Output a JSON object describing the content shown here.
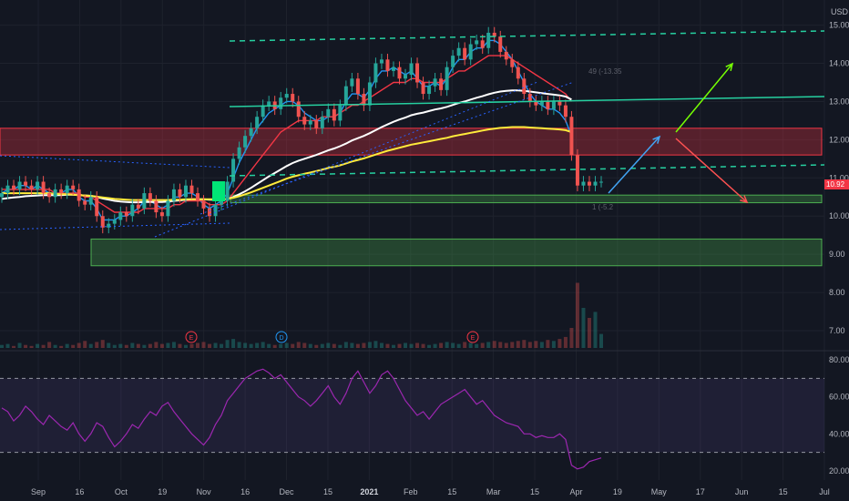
{
  "chart_data": [
    {
      "type": "candlestick",
      "title": "",
      "currency_label": "USD",
      "price_axis": {
        "ylim": [
          6.5,
          15.3
        ],
        "ticks": [
          "15.00",
          "14.00",
          "13.00",
          "12.00",
          "11.00",
          "10.00",
          "9.00",
          "8.00",
          "7.00"
        ]
      },
      "last_price": "10.92",
      "time_axis": [
        "Sep",
        "16",
        "Oct",
        "19",
        "Nov",
        "16",
        "Dec",
        "15",
        "2021",
        "Feb",
        "15",
        "Mar",
        "15",
        "Apr",
        "19",
        "May",
        "17",
        "Jun",
        "15",
        "Jul"
      ],
      "time_axis_bold": [
        "2021"
      ],
      "candles_close": [
        10.6,
        10.8,
        10.7,
        10.9,
        10.8,
        10.7,
        10.9,
        10.6,
        10.5,
        10.7,
        10.6,
        10.8,
        10.7,
        10.4,
        10.3,
        10.5,
        10.0,
        9.7,
        9.8,
        9.9,
        10.1,
        10.0,
        10.3,
        10.2,
        10.6,
        10.4,
        10.1,
        10.0,
        10.4,
        10.7,
        10.5,
        10.8,
        10.6,
        10.4,
        10.2,
        10.0,
        10.3,
        10.4,
        10.9,
        11.5,
        11.8,
        12.1,
        12.3,
        12.6,
        12.9,
        13.0,
        12.8,
        13.1,
        13.2,
        13.0,
        12.6,
        12.4,
        12.5,
        12.3,
        12.6,
        12.8,
        12.5,
        12.9,
        13.4,
        13.6,
        13.2,
        12.9,
        13.5,
        14.0,
        14.1,
        13.8,
        13.9,
        13.6,
        13.7,
        14.0,
        13.5,
        13.2,
        13.4,
        13.6,
        13.3,
        13.9,
        14.2,
        14.4,
        14.1,
        14.5,
        14.6,
        14.4,
        14.8,
        14.7,
        14.3,
        14.1,
        13.9,
        13.6,
        13.2,
        13.0,
        12.9,
        13.0,
        12.8,
        13.0,
        12.9,
        12.6,
        11.6,
        10.8,
        10.9,
        10.8,
        10.9,
        10.9
      ],
      "moving_averages": [
        {
          "color": "#2196f3",
          "values": [
            10.6,
            10.7,
            10.7,
            10.8,
            10.8,
            10.7,
            10.8,
            10.7,
            10.6,
            10.6,
            10.6,
            10.7,
            10.7,
            10.5,
            10.4,
            10.4,
            10.2,
            9.9,
            9.9,
            9.9,
            10.0,
            10.0,
            10.1,
            10.2,
            10.4,
            10.4,
            10.3,
            10.2,
            10.3,
            10.5,
            10.5,
            10.6,
            10.6,
            10.5,
            10.3,
            10.2,
            10.3,
            10.4,
            10.6,
            11.0,
            11.4,
            11.7,
            12.0,
            12.3,
            12.5,
            12.7,
            12.8,
            12.9,
            13.0,
            13.0,
            12.9,
            12.7,
            12.6,
            12.5,
            12.5,
            12.6,
            12.6,
            12.7,
            13.0,
            13.2,
            13.2,
            13.1,
            13.3,
            13.6,
            13.8,
            13.8,
            13.9,
            13.8,
            13.7,
            13.8,
            13.6,
            13.4,
            13.4,
            13.5,
            13.4,
            13.6,
            13.9,
            14.1,
            14.1,
            14.3,
            14.4,
            14.4,
            14.6,
            14.6,
            14.5,
            14.3,
            14.1,
            13.8,
            13.5,
            13.2,
            13.0,
            12.9,
            12.8,
            12.8,
            12.7,
            12.5,
            12.1
          ]
        },
        {
          "color": "#f23645",
          "values": [
            10.7,
            10.7,
            10.7,
            10.7,
            10.7,
            10.7,
            10.7,
            10.7,
            10.7,
            10.6,
            10.6,
            10.6,
            10.6,
            10.6,
            10.5,
            10.5,
            10.4,
            10.3,
            10.2,
            10.1,
            10.1,
            10.1,
            10.1,
            10.1,
            10.2,
            10.2,
            10.2,
            10.2,
            10.2,
            10.3,
            10.3,
            10.4,
            10.4,
            10.4,
            10.4,
            10.3,
            10.3,
            10.3,
            10.4,
            10.6,
            10.8,
            11.0,
            11.2,
            11.4,
            11.6,
            11.8,
            12.0,
            12.2,
            12.3,
            12.4,
            12.5,
            12.5,
            12.5,
            12.5,
            12.6,
            12.6,
            12.6,
            12.7,
            12.8,
            12.9,
            12.9,
            13.0,
            13.1,
            13.2,
            13.3,
            13.4,
            13.5,
            13.5,
            13.5,
            13.6,
            13.6,
            13.5,
            13.5,
            13.5,
            13.5,
            13.6,
            13.7,
            13.8,
            13.8,
            13.9,
            14.0,
            14.1,
            14.2,
            14.2,
            14.2,
            14.2,
            14.1,
            14.0,
            13.9,
            13.8,
            13.7,
            13.6,
            13.5,
            13.4,
            13.3,
            13.2,
            13.0
          ]
        },
        {
          "color": "#ffffff",
          "values": [
            10.45,
            10.47,
            10.49,
            10.5,
            10.52,
            10.53,
            10.54,
            10.55,
            10.55,
            10.55,
            10.55,
            10.56,
            10.56,
            10.55,
            10.54,
            10.53,
            10.5,
            10.46,
            10.43,
            10.4,
            10.38,
            10.37,
            10.36,
            10.36,
            10.37,
            10.37,
            10.37,
            10.37,
            10.38,
            10.4,
            10.41,
            10.43,
            10.44,
            10.44,
            10.44,
            10.43,
            10.43,
            10.43,
            10.45,
            10.5,
            10.57,
            10.65,
            10.74,
            10.84,
            10.94,
            11.04,
            11.13,
            11.22,
            11.31,
            11.39,
            11.45,
            11.5,
            11.55,
            11.6,
            11.66,
            11.72,
            11.77,
            11.83,
            11.9,
            11.98,
            12.04,
            12.1,
            12.17,
            12.25,
            12.33,
            12.4,
            12.47,
            12.53,
            12.58,
            12.64,
            12.68,
            12.71,
            12.75,
            12.79,
            12.82,
            12.86,
            12.91,
            12.96,
            13.0,
            13.05,
            13.1,
            13.14,
            13.19,
            13.23,
            13.26,
            13.28,
            13.29,
            13.29,
            13.28,
            13.26,
            13.24,
            13.22,
            13.2,
            13.18,
            13.16,
            13.13,
            13.05
          ]
        },
        {
          "color": "#ffeb3b",
          "values": [
            10.6,
            10.6,
            10.6,
            10.6,
            10.6,
            10.6,
            10.6,
            10.6,
            10.6,
            10.58,
            10.57,
            10.57,
            10.56,
            10.55,
            10.54,
            10.53,
            10.51,
            10.49,
            10.47,
            10.45,
            10.44,
            10.43,
            10.42,
            10.42,
            10.42,
            10.42,
            10.42,
            10.42,
            10.42,
            10.43,
            10.43,
            10.44,
            10.44,
            10.44,
            10.44,
            10.44,
            10.44,
            10.44,
            10.45,
            10.48,
            10.52,
            10.57,
            10.62,
            10.68,
            10.74,
            10.8,
            10.86,
            10.92,
            10.98,
            11.03,
            11.07,
            11.11,
            11.14,
            11.18,
            11.22,
            11.26,
            11.29,
            11.33,
            11.38,
            11.43,
            11.47,
            11.51,
            11.56,
            11.61,
            11.66,
            11.71,
            11.75,
            11.79,
            11.83,
            11.87,
            11.9,
            11.93,
            11.96,
            11.99,
            12.02,
            12.05,
            12.09,
            12.12,
            12.15,
            12.18,
            12.21,
            12.24,
            12.27,
            12.29,
            12.31,
            12.32,
            12.33,
            12.33,
            12.33,
            12.32,
            12.31,
            12.3,
            12.29,
            12.28,
            12.27,
            12.25,
            12.2
          ]
        }
      ],
      "zones": [
        {
          "color": "#f23645",
          "range": [
            11.6,
            12.3
          ]
        },
        {
          "color": "#4caf50",
          "range": [
            10.35,
            10.55
          ]
        },
        {
          "color": "#4caf50",
          "range": [
            8.7,
            9.4
          ]
        }
      ],
      "annotations": [
        {
          "text": "49 (-13.35",
          "color": "#5d606b"
        },
        {
          "text": "1 (-5.2",
          "color": "#5d606b"
        }
      ],
      "event_markers": [
        {
          "label": "E",
          "color": "#f23645"
        },
        {
          "label": "D",
          "color": "#2196f3"
        },
        {
          "label": "E",
          "color": "#f23645"
        }
      ],
      "volume": [
        0.3,
        0.4,
        0.2,
        0.5,
        0.3,
        0.2,
        0.4,
        0.3,
        0.6,
        0.3,
        0.2,
        0.4,
        0.3,
        0.5,
        0.7,
        0.4,
        0.6,
        0.8,
        0.5,
        0.3,
        0.4,
        0.3,
        0.5,
        0.4,
        0.3,
        0.4,
        0.6,
        0.4,
        0.5,
        0.6,
        0.4,
        0.3,
        0.4,
        0.5,
        0.6,
        0.4,
        0.5,
        0.4,
        0.8,
        0.9,
        0.6,
        0.5,
        0.4,
        0.5,
        0.6,
        0.4,
        0.3,
        0.4,
        0.5,
        0.4,
        0.6,
        0.5,
        0.4,
        0.3,
        0.4,
        0.5,
        0.4,
        0.3,
        0.6,
        0.5,
        0.4,
        0.5,
        0.6,
        0.7,
        0.5,
        0.4,
        0.3,
        0.4,
        0.5,
        0.4,
        0.5,
        0.4,
        0.3,
        0.4,
        0.5,
        0.6,
        0.5,
        0.4,
        0.6,
        0.5,
        0.4,
        0.5,
        0.6,
        0.7,
        0.6,
        0.5,
        0.6,
        0.7,
        0.8,
        0.6,
        0.7,
        0.6,
        0.8,
        0.7,
        0.9,
        1.1,
        2.0,
        6.5,
        4.0,
        3.0,
        3.6,
        1.4
      ]
    },
    {
      "type": "line",
      "title": "",
      "ylim": [
        15,
        85
      ],
      "ticks": [
        "80.00",
        "60.00",
        "40.00",
        "20.00"
      ],
      "band": {
        "color": "#7e57c2",
        "range": [
          30,
          70
        ]
      },
      "line_color": "#9c27b0",
      "values": [
        54,
        52,
        47,
        50,
        55,
        52,
        48,
        45,
        50,
        47,
        44,
        42,
        46,
        40,
        36,
        40,
        46,
        44,
        38,
        33,
        36,
        40,
        45,
        43,
        48,
        52,
        50,
        55,
        57,
        52,
        48,
        44,
        40,
        37,
        34,
        38,
        45,
        50,
        58,
        62,
        66,
        70,
        72,
        74,
        75,
        73,
        70,
        72,
        68,
        64,
        60,
        58,
        55,
        58,
        62,
        66,
        60,
        56,
        62,
        70,
        74,
        68,
        62,
        66,
        72,
        74,
        70,
        64,
        58,
        54,
        50,
        52,
        48,
        52,
        56,
        58,
        60,
        62,
        64,
        60,
        56,
        58,
        54,
        50,
        48,
        46,
        45,
        44,
        40,
        40,
        38,
        39,
        38,
        38,
        40,
        37,
        23,
        21,
        22,
        25,
        26,
        27
      ]
    }
  ]
}
